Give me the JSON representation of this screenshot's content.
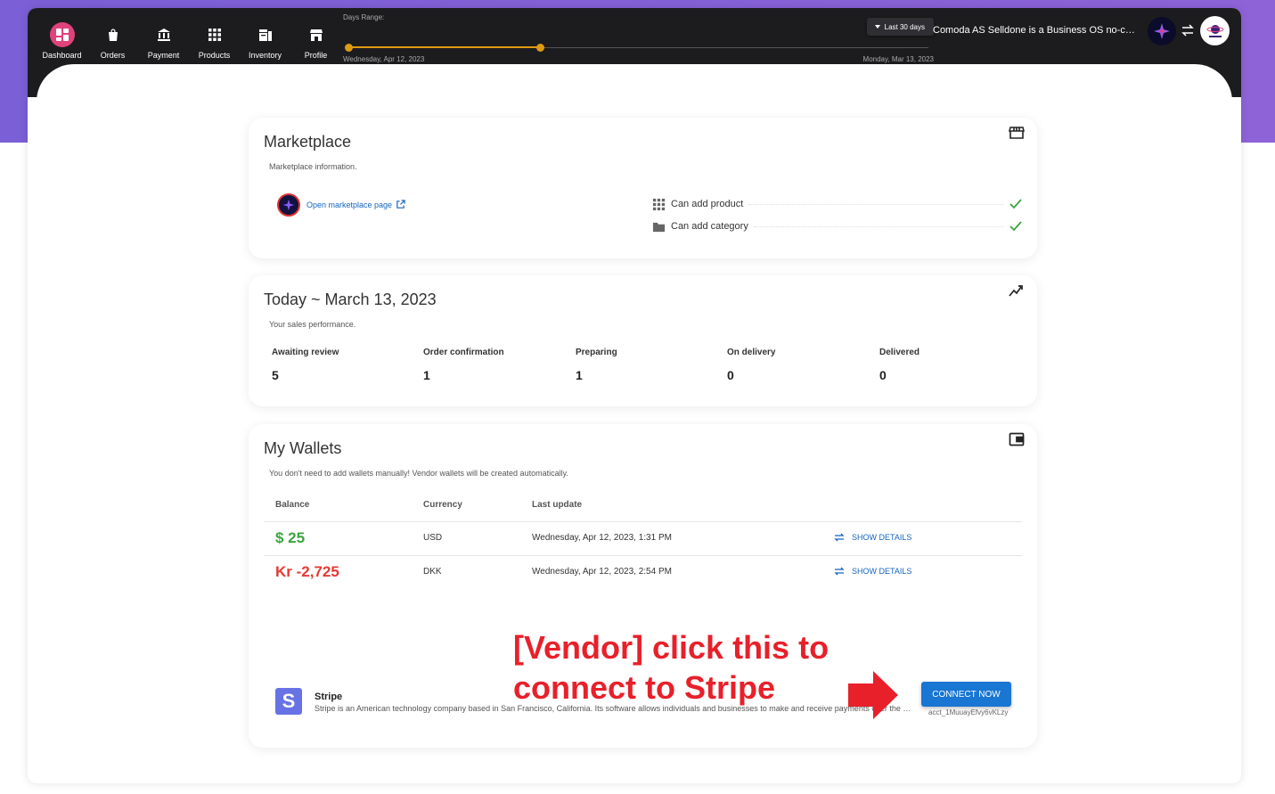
{
  "nav": [
    {
      "label": "Dashboard",
      "icon": "dashboard-icon",
      "active": true
    },
    {
      "label": "Orders",
      "icon": "shopping-bag-icon"
    },
    {
      "label": "Payment",
      "icon": "bank-icon"
    },
    {
      "label": "Products",
      "icon": "grid-icon"
    },
    {
      "label": "Inventory",
      "icon": "inventory-icon"
    },
    {
      "label": "Profile",
      "icon": "store-profile-icon"
    }
  ],
  "days_range": {
    "label": "Days Range:",
    "button": "Last 30 days",
    "start": "Wednesday, Apr 12, 2023",
    "end": "Monday, Mar 13, 2023",
    "selected_fraction": 0.33
  },
  "header": {
    "shop_name": "Comoda AS Selldone is a Business OS no-code platform"
  },
  "marketplace": {
    "title": "Marketplace",
    "subtitle": "Marketplace information.",
    "link": "Open marketplace page",
    "permissions": [
      "Can add product",
      "Can add category"
    ]
  },
  "sales": {
    "title": "Today ~ March 13, 2023",
    "subtitle": "Your sales performance.",
    "stats": [
      {
        "label": "Awaiting review",
        "value": "5"
      },
      {
        "label": "Order confirmation",
        "value": "1"
      },
      {
        "label": "Preparing",
        "value": "1"
      },
      {
        "label": "On delivery",
        "value": "0"
      },
      {
        "label": "Delivered",
        "value": "0"
      }
    ]
  },
  "wallets": {
    "title": "My Wallets",
    "subtitle": "You don't need to add wallets manually! Vendor wallets will be created automatically.",
    "columns": {
      "balance": "Balance",
      "currency": "Currency",
      "last_update": "Last update"
    },
    "rows": [
      {
        "balance": "$ 25",
        "currency": "USD",
        "last_update": "Wednesday, Apr 12, 2023, 1:31 PM",
        "action": "SHOW DETAILS",
        "color": "#3aa53e"
      },
      {
        "balance": "Kr -2,725",
        "currency": "DKK",
        "last_update": "Wednesday, Apr 12, 2023, 2:54 PM",
        "action": "SHOW DETAILS",
        "color": "#e53935"
      }
    ]
  },
  "stripe": {
    "logo_letter": "S",
    "title": "Stripe",
    "description": "Stripe is an American technology company based in San Francisco, California. Its software allows individuals and businesses to make and receive payments over the Internet.",
    "button": "CONNECT NOW",
    "account": "acct_1MuuayEfvy6vKLzy"
  },
  "annotation": {
    "line1": "[Vendor] click this to",
    "line2": "connect to Stripe",
    "color": "#e8202a"
  },
  "colors": {
    "accent": "#1976d2",
    "nav_active": "#e0427a",
    "slider": "#e09a12",
    "success": "#3aa53e"
  }
}
